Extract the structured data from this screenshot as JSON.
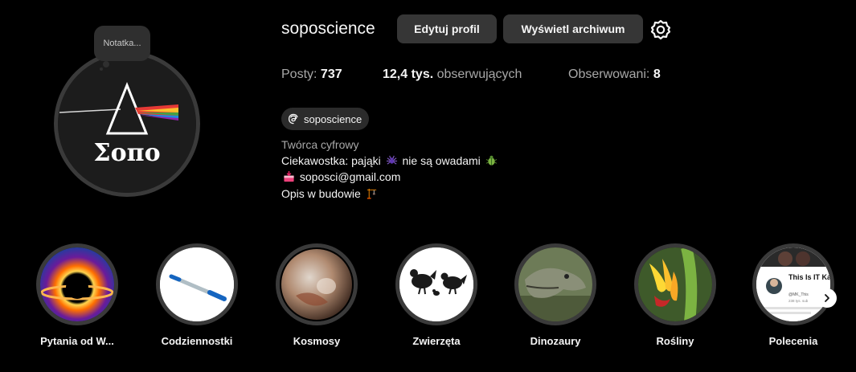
{
  "profile": {
    "username": "soposcience",
    "note_label": "Notatka...",
    "avatar_text": "Σoπo",
    "edit_label": "Edytuj profil",
    "archive_label": "Wyświetl archiwum",
    "settings_icon": "gear-icon"
  },
  "stats": {
    "posts_label": "Posty:",
    "posts_value": "737",
    "followers_value": "12,4 tys.",
    "followers_label": "obserwujących",
    "following_label": "Obserwowani:",
    "following_value": "8"
  },
  "threads": {
    "handle": "soposcience",
    "icon": "threads-icon"
  },
  "bio": {
    "category": "Twórca cyfrowy",
    "line1_a": "Ciekawostka: pająki",
    "line1_b": "nie są owadami",
    "line2": "soposci@gmail.com",
    "line3": "Opis w budowie"
  },
  "highlights": [
    {
      "label": "Pytania od W..."
    },
    {
      "label": "Codziennostki"
    },
    {
      "label": "Kosmosy"
    },
    {
      "label": "Zwierzęta"
    },
    {
      "label": "Dinozaury"
    },
    {
      "label": "Rośliny"
    },
    {
      "label": "Polecenia",
      "thumb_title": "This Is IT Kawecki",
      "thumb_handle": "@MK_This",
      "thumb_meta": "238 tys. sub"
    }
  ],
  "colors": {
    "background": "#000000",
    "button": "#363636",
    "muted_text": "#a8a8a8"
  }
}
